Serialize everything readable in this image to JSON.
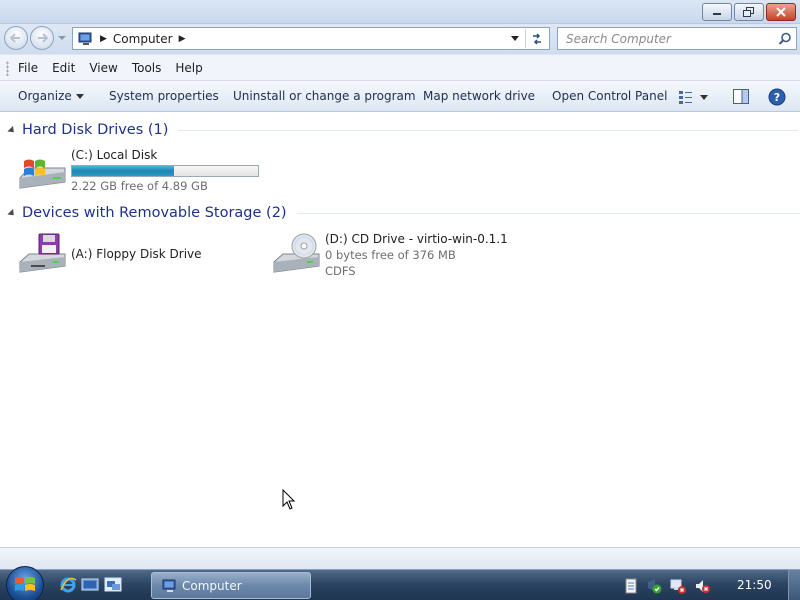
{
  "window": {
    "title": "Computer",
    "caption_buttons": [
      "minimize",
      "restore",
      "close"
    ]
  },
  "address_bar": {
    "crumbs": [
      "Computer"
    ],
    "search_placeholder": "Search Computer"
  },
  "menu": {
    "items": [
      "File",
      "Edit",
      "View",
      "Tools",
      "Help"
    ]
  },
  "command_bar": {
    "organize": "Organize",
    "system_properties": "System properties",
    "uninstall": "Uninstall or change a program",
    "map_drive": "Map network drive",
    "control_panel": "Open Control Panel"
  },
  "groups": {
    "hard_disks": {
      "title": "Hard Disk Drives (1)",
      "drives": [
        {
          "name": "(C:) Local Disk",
          "free_text": "2.22 GB free of 4.89 GB",
          "used_fraction": 0.546,
          "icon": "windows-hard-disk-icon"
        }
      ]
    },
    "removable": {
      "title": "Devices with Removable Storage (2)",
      "drives": [
        {
          "name": "(A:) Floppy Disk Drive",
          "icon": "floppy-drive-icon"
        },
        {
          "name": "(D:) CD Drive - virtio-win-0.1.1",
          "free_text": "0 bytes free of 376 MB",
          "filesystem": "CDFS",
          "icon": "cd-drive-icon"
        }
      ]
    }
  },
  "taskbar": {
    "active_window": "Computer",
    "clock": "21:50",
    "quick_launch": [
      "internet-explorer-icon",
      "show-desktop-icon",
      "switch-windows-icon"
    ],
    "tray_icons": [
      "document-icon",
      "action-center-icon",
      "network-icon",
      "volume-muted-icon"
    ]
  },
  "colors": {
    "group_title": "#1e3287",
    "progress_fill": "#1d86b4"
  }
}
